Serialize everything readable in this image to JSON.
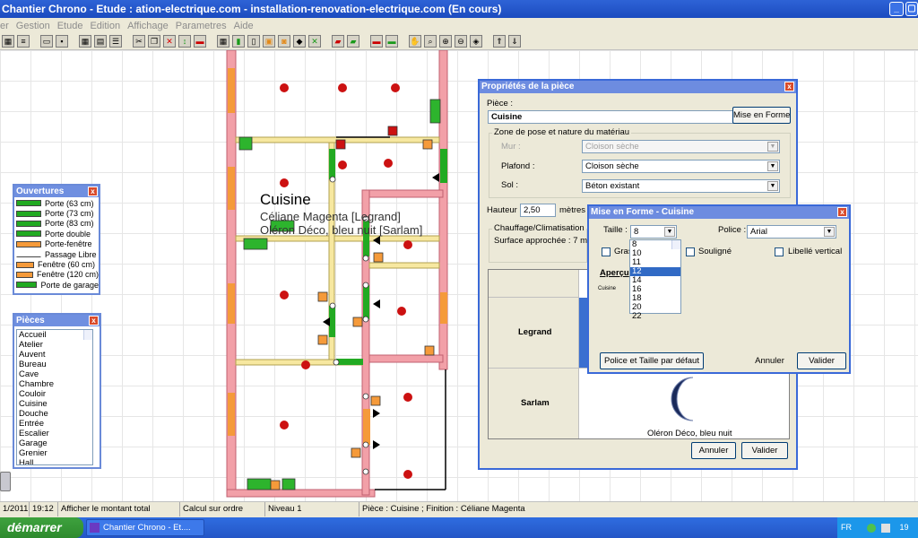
{
  "window": {
    "title": "Chantier Chrono - Etude : ation-electrique.com - installation-renovation-electrique.com (En cours)",
    "min": "_"
  },
  "menu": [
    "er",
    "Gestion",
    "Etude",
    "Edition",
    "Affichage",
    "Parametres",
    "Aide"
  ],
  "plan": {
    "room_name": "Cuisine",
    "room_finish": "Céliane Magenta [Legrand]",
    "room_finish2": "Oléron Déco, bleu nuit [Sarlam]"
  },
  "ouvertures": {
    "title": "Ouvertures",
    "close": "x",
    "items": [
      {
        "label": "Porte (63 cm)",
        "color": "#22aa22"
      },
      {
        "label": "Porte (73 cm)",
        "color": "#22aa22"
      },
      {
        "label": "Porte (83 cm)",
        "color": "#22aa22"
      },
      {
        "label": "Porte double",
        "color": "#22aa22"
      },
      {
        "label": "Porte-fenêtre",
        "color": "#f59a3a"
      },
      {
        "label": "Passage Libre",
        "color": "#ffffff"
      },
      {
        "label": "Fenêtre (60 cm)",
        "color": "#f59a3a"
      },
      {
        "label": "Fenêtre (120 cm)",
        "color": "#f59a3a"
      },
      {
        "label": "Porte de garage",
        "color": "#22aa22"
      }
    ]
  },
  "pieces": {
    "title": "Pièces",
    "close": "x",
    "items": [
      "Accueil",
      "Atelier",
      "Auvent",
      "Bureau",
      "Cave",
      "Chambre",
      "Couloir",
      "Cuisine",
      "Douche",
      "Entrée",
      "Escalier",
      "Garage",
      "Grenier",
      "Hall"
    ]
  },
  "props": {
    "title": "Propriétés de la pièce",
    "close": "x",
    "piece_label": "Pièce :",
    "piece_value": "Cuisine",
    "mise_btn": "Mise en Forme",
    "zone_label": "Zone de pose et nature du matériau",
    "mur_label": "Mur :",
    "mur_value": "Cloison sèche",
    "plafond_label": "Plafond :",
    "plafond_value": "Cloison sèche",
    "sol_label": "Sol :",
    "sol_value": "Béton existant",
    "hauteur_label": "Hauteur :",
    "hauteur_value": "2,50",
    "hauteur_unit": "mètres",
    "chauffage_label": "Chauffage/Climatisation",
    "surface_label": "Surface approchée : 7 m²",
    "grid_row1": "Legrand",
    "grid_row2": "Sarlam",
    "sarlam_caption": "Oléron Déco, bleu nuit",
    "annuler": "Annuler",
    "valider": "Valider"
  },
  "mef": {
    "title": "Mise en Forme - Cuisine",
    "close": "x",
    "taille_label": "Taille :",
    "taille_value": "8",
    "police_label": "Police :",
    "police_value": "Arial",
    "gras_label": "Gras",
    "souligne_label": "Souligné",
    "libelle_label": "Libellé vertical",
    "apercu_label": "Aperçu",
    "apercu_text": "Cuisine",
    "sizes": [
      "8",
      "10",
      "11",
      "12",
      "14",
      "16",
      "18",
      "20",
      "22"
    ],
    "selected_size": "12",
    "defaut_btn": "Police et Taille par défaut",
    "annuler": "Annuler",
    "valider": "Valider"
  },
  "status": [
    "1/2011",
    "19:12",
    "Afficher le montant total",
    "Calcul sur ordre",
    "Niveau 1",
    "Pièce : Cuisine ; Finition : Céliane Magenta"
  ],
  "taskbar": {
    "start": "démarrer",
    "task": "Chantier Chrono - Et....",
    "tray_lang": "FR",
    "clock": "19"
  }
}
